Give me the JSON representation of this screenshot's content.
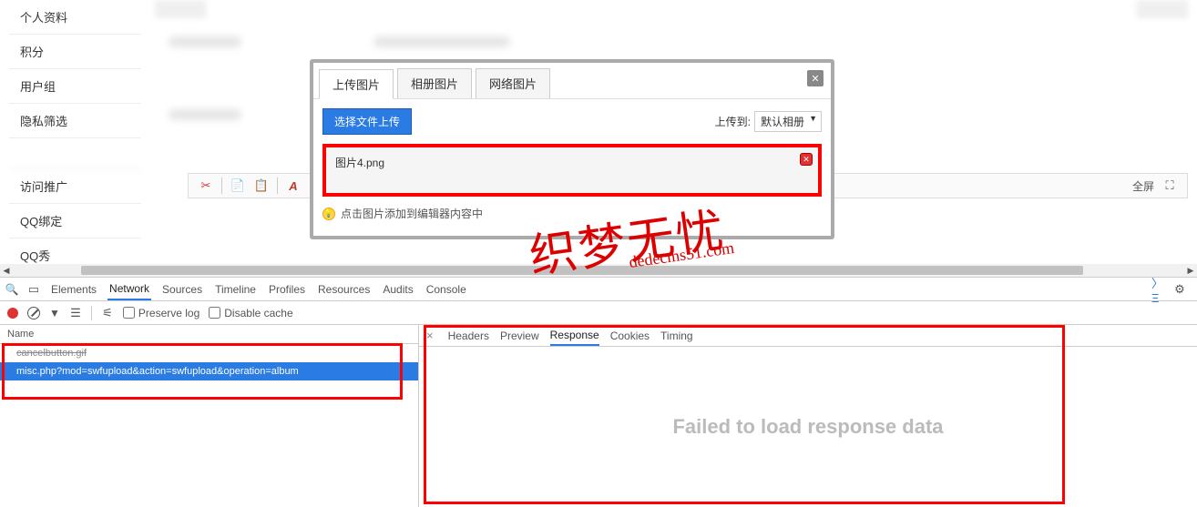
{
  "sidebar": {
    "items": [
      {
        "label": "个人资料"
      },
      {
        "label": "积分"
      },
      {
        "label": "用户组"
      },
      {
        "label": "隐私筛选"
      },
      {
        "label": "   "
      },
      {
        "label": "访问推广"
      },
      {
        "label": "QQ绑定"
      },
      {
        "label": "QQ秀"
      }
    ]
  },
  "editor_toolbar": {
    "fullscreen": "全屏"
  },
  "modal": {
    "tabs": [
      {
        "label": "上传图片"
      },
      {
        "label": "相册图片"
      },
      {
        "label": "网络图片"
      }
    ],
    "upload_btn": "选择文件上传",
    "upload_to_label": "上传到:",
    "album_select": "默认相册",
    "file_name": "图片4.png",
    "tip_text": "点击图片添加到编辑器内容中"
  },
  "watermark": {
    "chinese": "织梦无忧",
    "url": "dedecms51.com"
  },
  "devtools": {
    "tabs": [
      "Elements",
      "Network",
      "Sources",
      "Timeline",
      "Profiles",
      "Resources",
      "Audits",
      "Console"
    ],
    "toolbar": {
      "preserve_log": "Preserve log",
      "disable_cache": "Disable cache"
    },
    "columns": {
      "name": "Name"
    },
    "requests": [
      {
        "name": "cancelbutton.gif"
      },
      {
        "name": "misc.php?mod=swfupload&action=swfupload&operation=album"
      }
    ],
    "response_tabs": [
      "Headers",
      "Preview",
      "Response",
      "Cookies",
      "Timing"
    ],
    "fail_msg": "Failed to load response data"
  }
}
